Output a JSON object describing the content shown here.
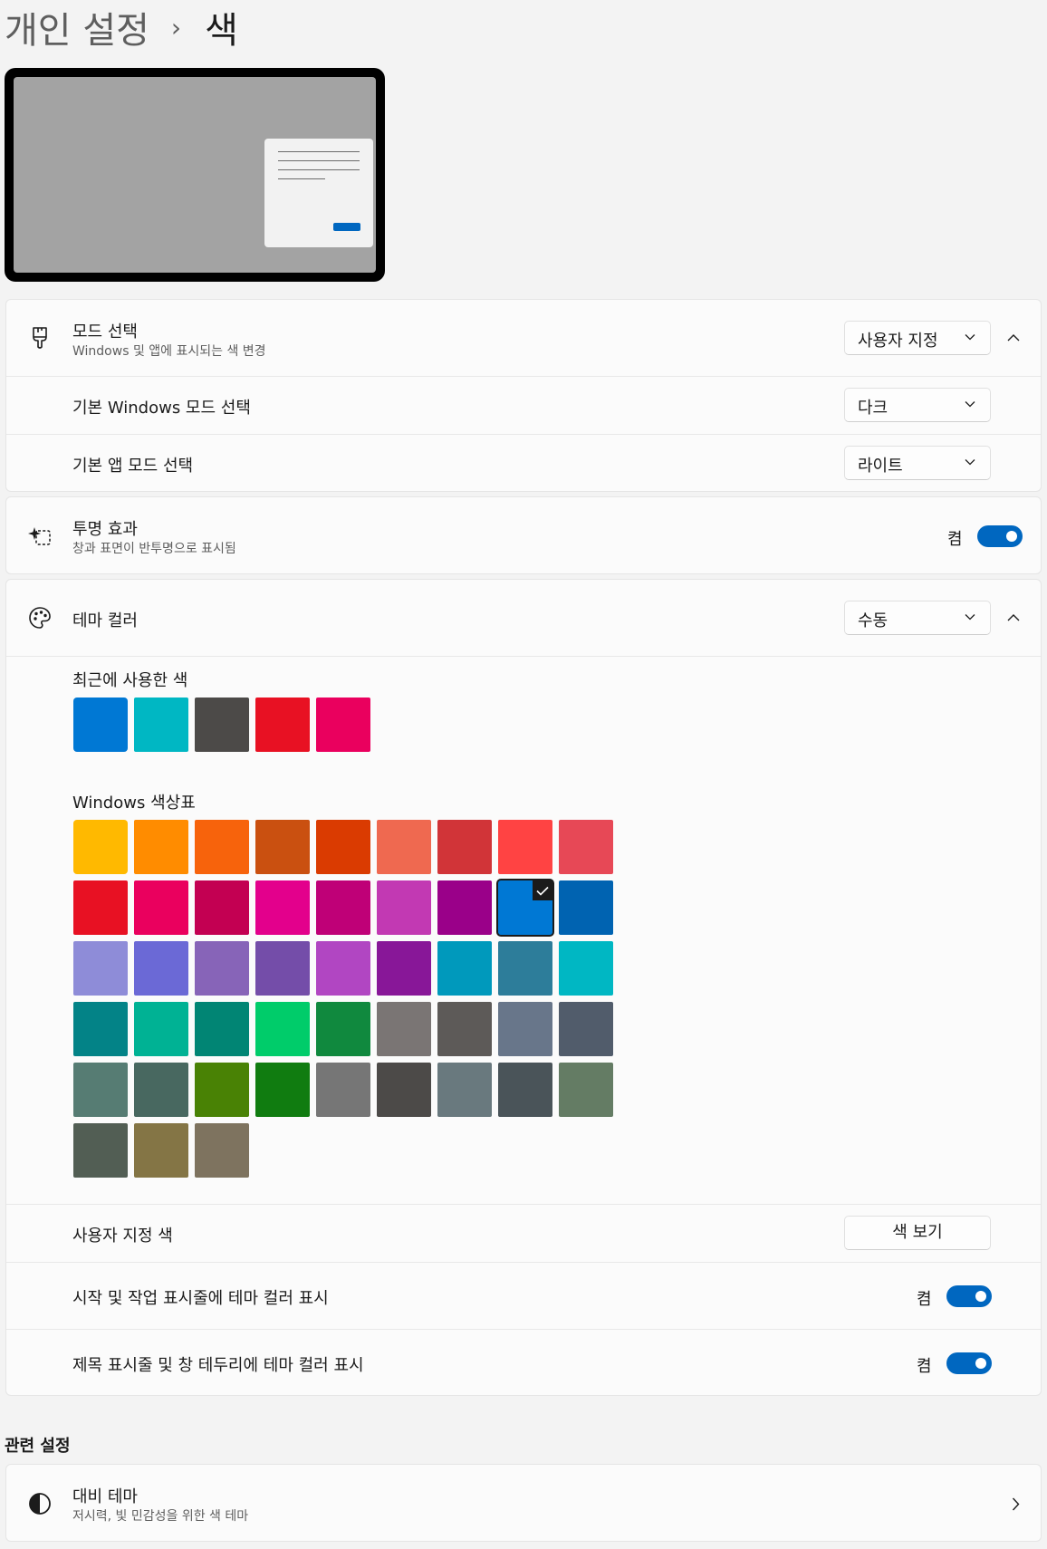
{
  "breadcrumb": {
    "parent": "개인 설정",
    "separator": "›",
    "current": "색"
  },
  "mode": {
    "title": "모드 선택",
    "subtitle": "Windows 및 앱에 표시되는 색 변경",
    "value": "사용자 지정",
    "windows_mode_label": "기본 Windows 모드 선택",
    "windows_mode_value": "다크",
    "app_mode_label": "기본 앱 모드 선택",
    "app_mode_value": "라이트"
  },
  "transparency": {
    "title": "투명 효과",
    "subtitle": "창과 표면이 반투명으로 표시됨",
    "state_label": "켬"
  },
  "theme_color": {
    "title": "테마 컬러",
    "value": "수동",
    "recent_label": "최근에 사용한 색",
    "recent_colors": [
      "#0078d4",
      "#00b7c3",
      "#4c4a48",
      "#e81123",
      "#ea005e"
    ],
    "palette_label": "Windows 색상표",
    "palette": [
      "#ffb900",
      "#ff8c00",
      "#f7630c",
      "#ca5010",
      "#da3b01",
      "#ef6950",
      "#d13438",
      "#ff4343",
      "#e74856",
      "#e81123",
      "#ea005e",
      "#c30052",
      "#e3008c",
      "#bf0077",
      "#c239b3",
      "#9a0089",
      "#0078d4",
      "#0063b1",
      "#8e8cd8",
      "#6b69d6",
      "#8764b8",
      "#744da9",
      "#b146c2",
      "#881798",
      "#0099bc",
      "#2d7d9a",
      "#00b7c3",
      "#038387",
      "#00b294",
      "#018574",
      "#00cc6a",
      "#10893e",
      "#7a7574",
      "#5d5a58",
      "#68768a",
      "#515c6b",
      "#567c73",
      "#486860",
      "#498205",
      "#107c10",
      "#767676",
      "#4c4a48",
      "#69797e",
      "#4a5459",
      "#647c64",
      "#525e54",
      "#847545",
      "#7e735f"
    ],
    "selected_color": "#0078d4",
    "custom_label": "사용자 지정 색",
    "view_colors_button": "색 보기",
    "start_taskbar_label": "시작 및 작업 표시줄에 테마 컬러 표시",
    "start_taskbar_state": "켬",
    "title_bar_label": "제목 표시줄 및 창 테두리에 테마 컬러 표시",
    "title_bar_state": "켬"
  },
  "related": {
    "heading": "관련 설정",
    "contrast_title": "대비 테마",
    "contrast_subtitle": "저시력, 빛 민감성을 위한 색 테마"
  },
  "colors": {
    "accent": "#0067c0",
    "background": "#f3f3f3",
    "card": "#fbfbfb"
  }
}
